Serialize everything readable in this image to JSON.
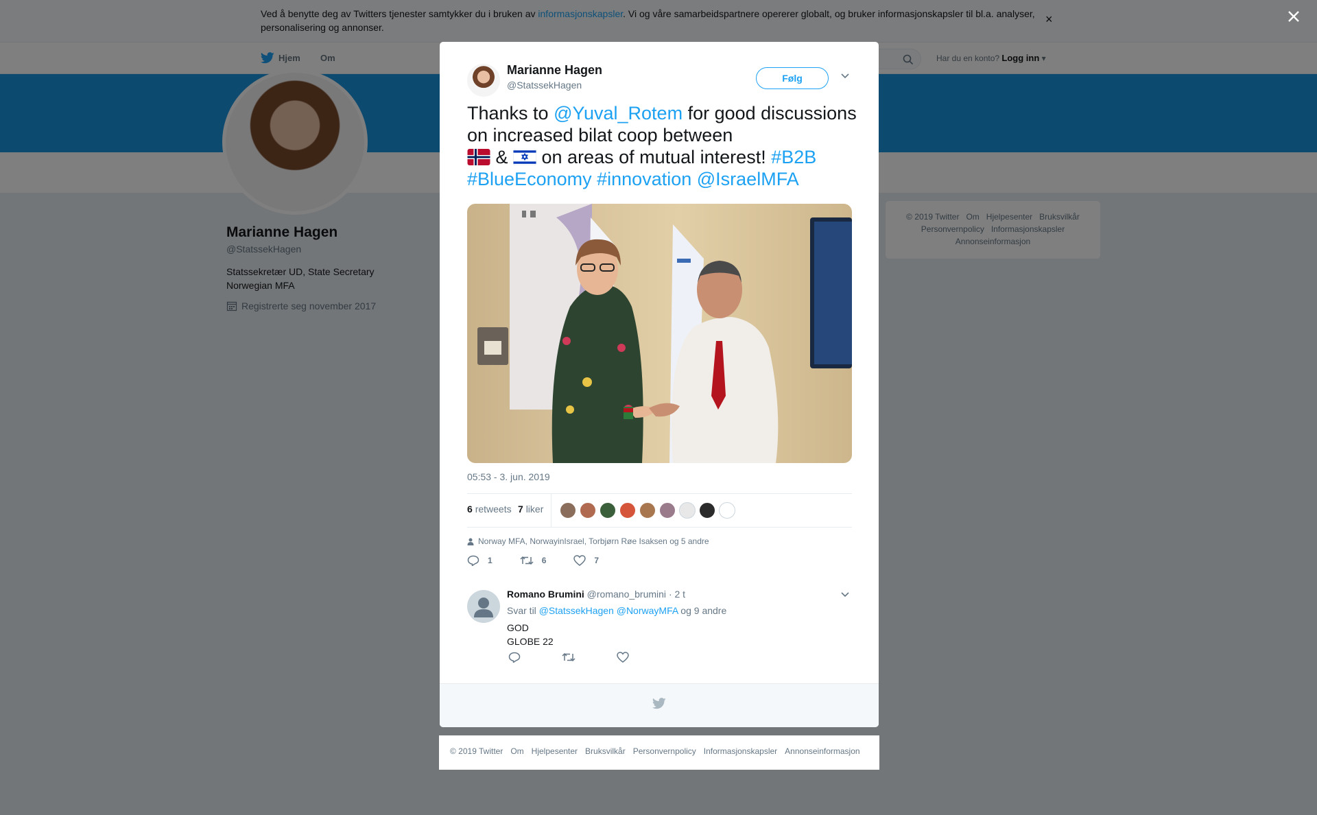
{
  "cookie": {
    "text_before": "Ved å benytte deg av Twitters tjenester samtykker du i bruken av ",
    "link": "informasjonskapsler",
    "text_after": ". Vi og våre samarbeidspartnere opererer globalt, og bruker informasjonskapsler til bl.a. analyser, personalisering og annonser.",
    "close": "×"
  },
  "nav": {
    "home": "Hjem",
    "about": "Om",
    "login_prompt": "Har du en konto?",
    "login": "Logg inn"
  },
  "profile": {
    "name": "Marianne Hagen",
    "handle": "@StatssekHagen",
    "bio_line1": "Statssekretær UD, State Secretary",
    "bio_line2": "Norwegian MFA",
    "joined": "Registrerte seg november 2017"
  },
  "side_footer": {
    "links": [
      "© 2019 Twitter",
      "Om",
      "Hjelpesenter",
      "Bruksvilkår",
      "Personvernpolicy",
      "Informasjonskapsler",
      "Annonseinformasjon"
    ]
  },
  "tweet": {
    "author_name": "Marianne Hagen",
    "author_handle": "@StatssekHagen",
    "follow": "Følg",
    "t1": "Thanks to ",
    "mention1": "@Yuval_Rotem",
    "t2": " for good discussions on increased bilat coop between ",
    "t3": " & ",
    "t4": " on areas of mutual interest! ",
    "hashtag1": "#B2B",
    "hashtag2": "#BlueEconomy",
    "hashtag3": "#innovation",
    "mention2": "@IsraelMFA",
    "timestamp": "05:53 - 3. jun. 2019",
    "retweets_count": "6",
    "retweets_label": "retweets",
    "likes_count": "7",
    "likes_label": "liker",
    "context": "Norway MFA, NorwayinIsrael, Torbjørn Røe Isaksen og 5 andre",
    "reply_count": "1",
    "retweet_count": "6",
    "like_count": "7",
    "liker_colors": [
      "#8a6d5a",
      "#b06a4f",
      "#3b5f3a",
      "#d4553a",
      "#a8764f",
      "#9a7b8c",
      "#e8e8e8",
      "#2b2b2b",
      "#ffffff"
    ]
  },
  "reply": {
    "name": "Romano Brumini",
    "handle": "@romano_brumini",
    "time": "· 2 t",
    "to_prefix": "Svar til ",
    "to_mention1": "@StatssekHagen",
    "to_mention2": "@NorwayMFA",
    "to_suffix": " og 9 andre",
    "line1": "GOD",
    "line2": "GLOBE 22"
  },
  "footer": {
    "links": [
      "© 2019 Twitter",
      "Om",
      "Hjelpesenter",
      "Bruksvilkår",
      "Personvernpolicy",
      "Informasjonskapsler",
      "Annonseinformasjon"
    ]
  },
  "colors": {
    "accent": "#1da1f2",
    "banner": "#1b95e0",
    "text": "#14171a",
    "muted": "#657786"
  }
}
